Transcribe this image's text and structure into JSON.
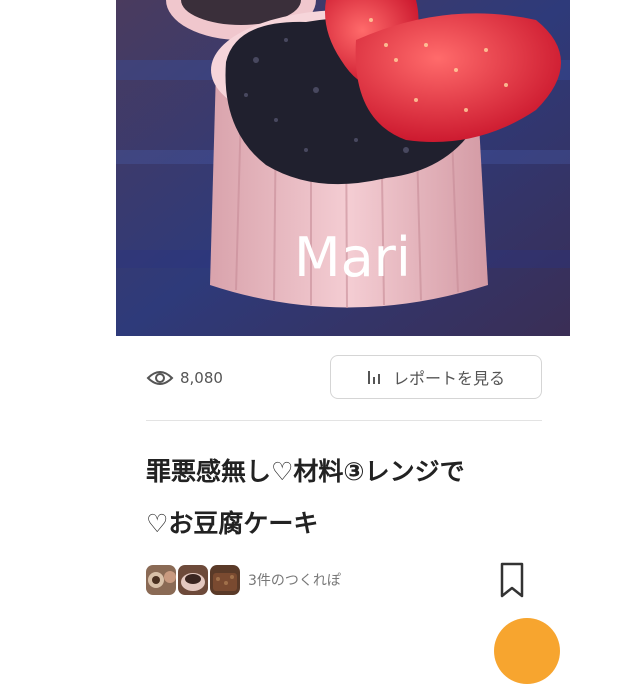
{
  "recipe": {
    "image_watermark": "Mari",
    "title_line1": "罪悪感無し♡材料③レンジで",
    "title_line2": "♡お豆腐ケーキ",
    "views_count": "8,080",
    "report_button_label": "レポートを見る",
    "tsukurepo_count_label": "3件のつくれぽ"
  },
  "icons": {
    "views": "eye-icon",
    "report": "bar-chart-icon",
    "bookmark": "bookmark-icon"
  },
  "colors": {
    "accent": "#f7a52f",
    "divider": "#e3e3e3"
  }
}
